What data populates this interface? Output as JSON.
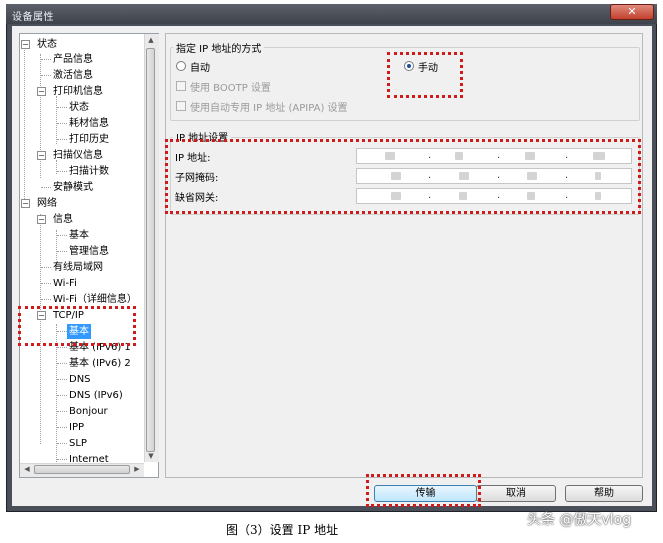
{
  "window": {
    "title": "设备属性",
    "close_glyph": "✕"
  },
  "tree": {
    "items": [
      {
        "label": "状态"
      },
      {
        "label": "产品信息"
      },
      {
        "label": "激活信息"
      },
      {
        "label": "打印机信息"
      },
      {
        "label": "状态"
      },
      {
        "label": "耗材信息"
      },
      {
        "label": "打印历史"
      },
      {
        "label": "扫描仪信息"
      },
      {
        "label": "扫描计数"
      },
      {
        "label": "安静模式"
      },
      {
        "label": "网络"
      },
      {
        "label": "信息"
      },
      {
        "label": "基本"
      },
      {
        "label": "管理信息"
      },
      {
        "label": "有线局域网"
      },
      {
        "label": "Wi-Fi"
      },
      {
        "label": "Wi-Fi（详细信息）"
      },
      {
        "label": "TCP/IP"
      },
      {
        "label": "基本"
      },
      {
        "label": "基本 (IPv6) 1"
      },
      {
        "label": "基本 (IPv6) 2"
      },
      {
        "label": "DNS"
      },
      {
        "label": "DNS (IPv6)"
      },
      {
        "label": "Bonjour"
      },
      {
        "label": "IPP"
      },
      {
        "label": "SLP"
      },
      {
        "label": "Internet"
      }
    ]
  },
  "settings": {
    "method_group_title": "指定 IP 地址的方式",
    "options": {
      "auto": "自动",
      "manual": "手动",
      "bootp": "使用 BOOTP 设置",
      "apipa": "使用自动专用 IP 地址 (APIPA) 设置"
    },
    "selected_method": "manual",
    "ip_group_title": "IP 地址设置",
    "fields": {
      "ip": "IP 地址:",
      "subnet": "子网掩码:",
      "gateway": "缺省网关:"
    },
    "ip_dot": "."
  },
  "buttons": {
    "send": "传输",
    "cancel": "取消",
    "help": "帮助"
  },
  "caption": "图（3）设置 IP 地址",
  "watermark": "头条 @傲天vlog"
}
